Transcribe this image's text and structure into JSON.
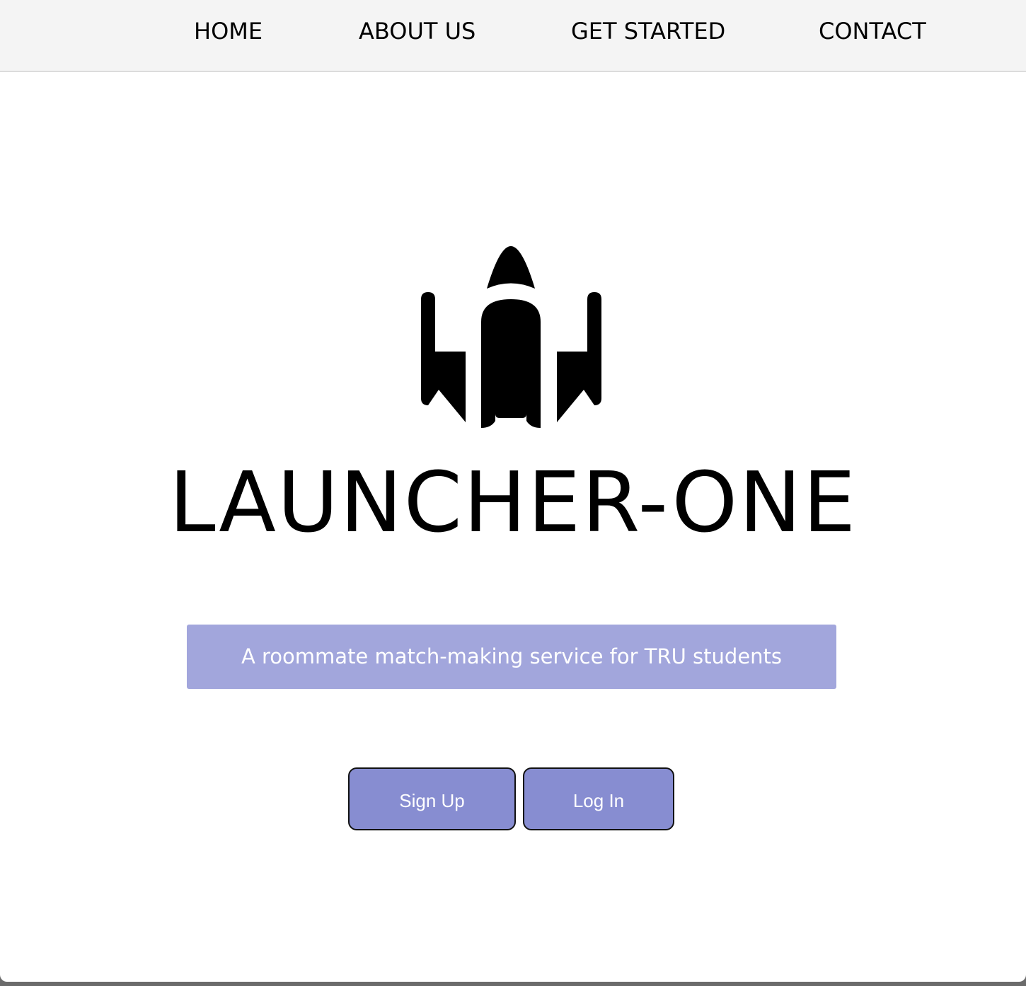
{
  "nav": {
    "items": [
      {
        "label": "HOME"
      },
      {
        "label": "ABOUT US"
      },
      {
        "label": "GET STARTED"
      },
      {
        "label": "CONTACT"
      }
    ]
  },
  "hero": {
    "logo_icon": "rocket-icon",
    "title": "LAUNCHER-ONE",
    "tagline": "A roommate match-making service for TRU students",
    "signup_label": "Sign Up",
    "login_label": "Log In"
  },
  "colors": {
    "nav_bg": "#f4f4f4",
    "tagline_bg": "#a2a6dc",
    "button_bg": "#878dd1",
    "text": "#000000"
  }
}
